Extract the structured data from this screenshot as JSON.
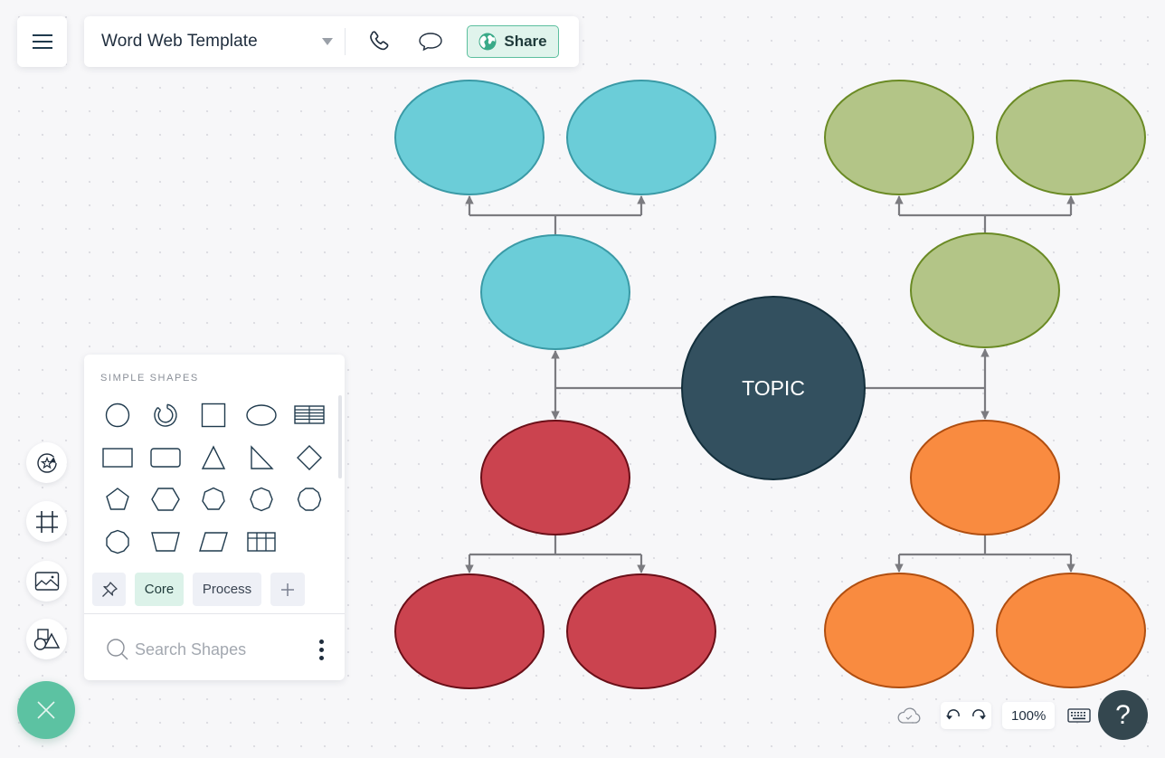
{
  "header": {
    "menu_icon": "hamburger-menu-icon",
    "document_title": "Word Web Template",
    "title_dropdown_icon": "caret-down-icon",
    "call_icon": "phone-icon",
    "comment_icon": "speech-bubble-icon",
    "share_label": "Share",
    "share_icon": "globe-icon"
  },
  "diagram": {
    "type": "word-web",
    "center": {
      "label": "TOPIC",
      "fill": "#33505f",
      "stroke": "#132f3c",
      "text_color": "#ffffff"
    },
    "connector_color": "#7b7b80",
    "branches": [
      {
        "id": "top-left",
        "fill": "#6bcdd8",
        "stroke": "#3a9aa6",
        "nodes": [
          "",
          "",
          ""
        ],
        "direction": "up"
      },
      {
        "id": "top-right",
        "fill": "#b3c587",
        "stroke": "#6a8a24",
        "nodes": [
          "",
          "",
          ""
        ],
        "direction": "up"
      },
      {
        "id": "bottom-left",
        "fill": "#cb434f",
        "stroke": "#6a0f18",
        "nodes": [
          "",
          "",
          ""
        ],
        "direction": "down"
      },
      {
        "id": "bottom-right",
        "fill": "#f98b40",
        "stroke": "#b04e10",
        "nodes": [
          "",
          "",
          ""
        ],
        "direction": "down"
      }
    ]
  },
  "shape_panel": {
    "heading": "SIMPLE SHAPES",
    "shapes": [
      "circle",
      "arc",
      "square",
      "ellipse",
      "table-striped",
      "rectangle",
      "rounded-rectangle",
      "triangle",
      "right-triangle",
      "diamond",
      "pentagon",
      "hexagon",
      "heptagon",
      "octagon",
      "nonagon",
      "decagon",
      "trapezoid",
      "parallelogram",
      "table-grid"
    ],
    "tabs": [
      {
        "label": "",
        "icon": "pin-icon",
        "active": false
      },
      {
        "label": "Core",
        "active": true
      },
      {
        "label": "Process",
        "active": false
      },
      {
        "label": "",
        "icon": "plus-icon",
        "active": false
      }
    ],
    "search": {
      "value": "",
      "placeholder": "Search Shapes"
    },
    "more_icon": "kebab-menu-icon"
  },
  "left_toolbar": [
    {
      "name": "sticker",
      "icon": "star-sticker-icon"
    },
    {
      "name": "frame",
      "icon": "frame-grid-icon"
    },
    {
      "name": "image",
      "icon": "image-icon"
    },
    {
      "name": "shapes",
      "icon": "shapes-icon"
    }
  ],
  "fab": {
    "icon": "close-icon"
  },
  "footer": {
    "save_status_icon": "cloud-check-icon",
    "undo_icon": "undo-icon",
    "redo_icon": "redo-icon",
    "zoom_level": "100%",
    "keyboard_icon": "keyboard-icon",
    "help_label": "?"
  }
}
